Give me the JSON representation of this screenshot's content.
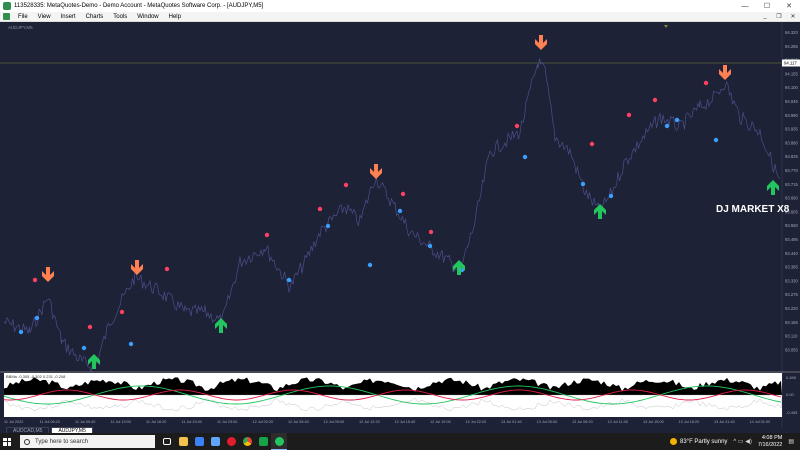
{
  "window": {
    "title": "113528335: MetaQuotes-Demo - Demo Account - MetaQuotes Software Corp. - [AUDJPY,M5]",
    "min_glyph": "—",
    "max_glyph": "☐",
    "close_glyph": "✕"
  },
  "menu": {
    "items": [
      "File",
      "View",
      "Insert",
      "Charts",
      "Tools",
      "Window",
      "Help"
    ],
    "mdi_min": "_",
    "mdi_restore": "❐",
    "mdi_close": "✕"
  },
  "chart": {
    "symbol_label": "AUDJPY,M5",
    "watermark": "DJ MARKET X8",
    "price_labels": [
      "94.320",
      "94.265",
      "94.210",
      "94.155",
      "94.100",
      "94.045",
      "93.990",
      "93.935",
      "93.880",
      "93.825",
      "93.770",
      "93.715",
      "93.660",
      "93.605",
      "93.550",
      "93.495",
      "93.440",
      "93.385",
      "93.330",
      "93.275",
      "93.220",
      "93.165",
      "93.110",
      "93.055"
    ],
    "current_price": "94.117",
    "time_labels": [
      "11 Jul 2022",
      "11 Jul 06:20",
      "11 Jul 09:40",
      "11 Jul 13:00",
      "11 Jul 16:20",
      "11 Jul 19:40",
      "11 Jul 23:00",
      "12 Jul 02:20",
      "12 Jul 05:40",
      "12 Jul 09:00",
      "12 Jul 12:20",
      "12 Jul 15:40",
      "12 Jul 19:00",
      "12 Jul 22:20",
      "13 Jul 01:40",
      "13 Jul 05:00",
      "13 Jul 08:20",
      "13 Jul 11:40",
      "13 Jul 15:00",
      "13 Jul 18:20",
      "13 Jul 21:40",
      "14 Jul 01:00"
    ],
    "colors": {
      "background": "#1e2236",
      "price_line": "#4a4f8a",
      "sell_arrow": "#ff8050",
      "buy_arrow": "#22c55e",
      "red_dot": "#ff4060",
      "blue_dot": "#3aa0ff",
      "current_line": "#7a8a3a"
    }
  },
  "indicator": {
    "label": "BBMa -0.305 -0.302 0.231 -0.208",
    "scale_top": "0.455",
    "scale_mid": "0.00",
    "scale_bot": "-0.455"
  },
  "tabs": [
    "AUDCAD,M5",
    "AUDJPY,M5"
  ],
  "taskbar": {
    "search_placeholder": "Type here to search",
    "weather": "83°F  Partly sunny",
    "time": "4:08 PM",
    "date": "7/16/2022",
    "icons": [
      "task-view",
      "file-explorer",
      "store",
      "mail",
      "opera",
      "chrome",
      "app-green",
      "metatrader"
    ]
  }
}
